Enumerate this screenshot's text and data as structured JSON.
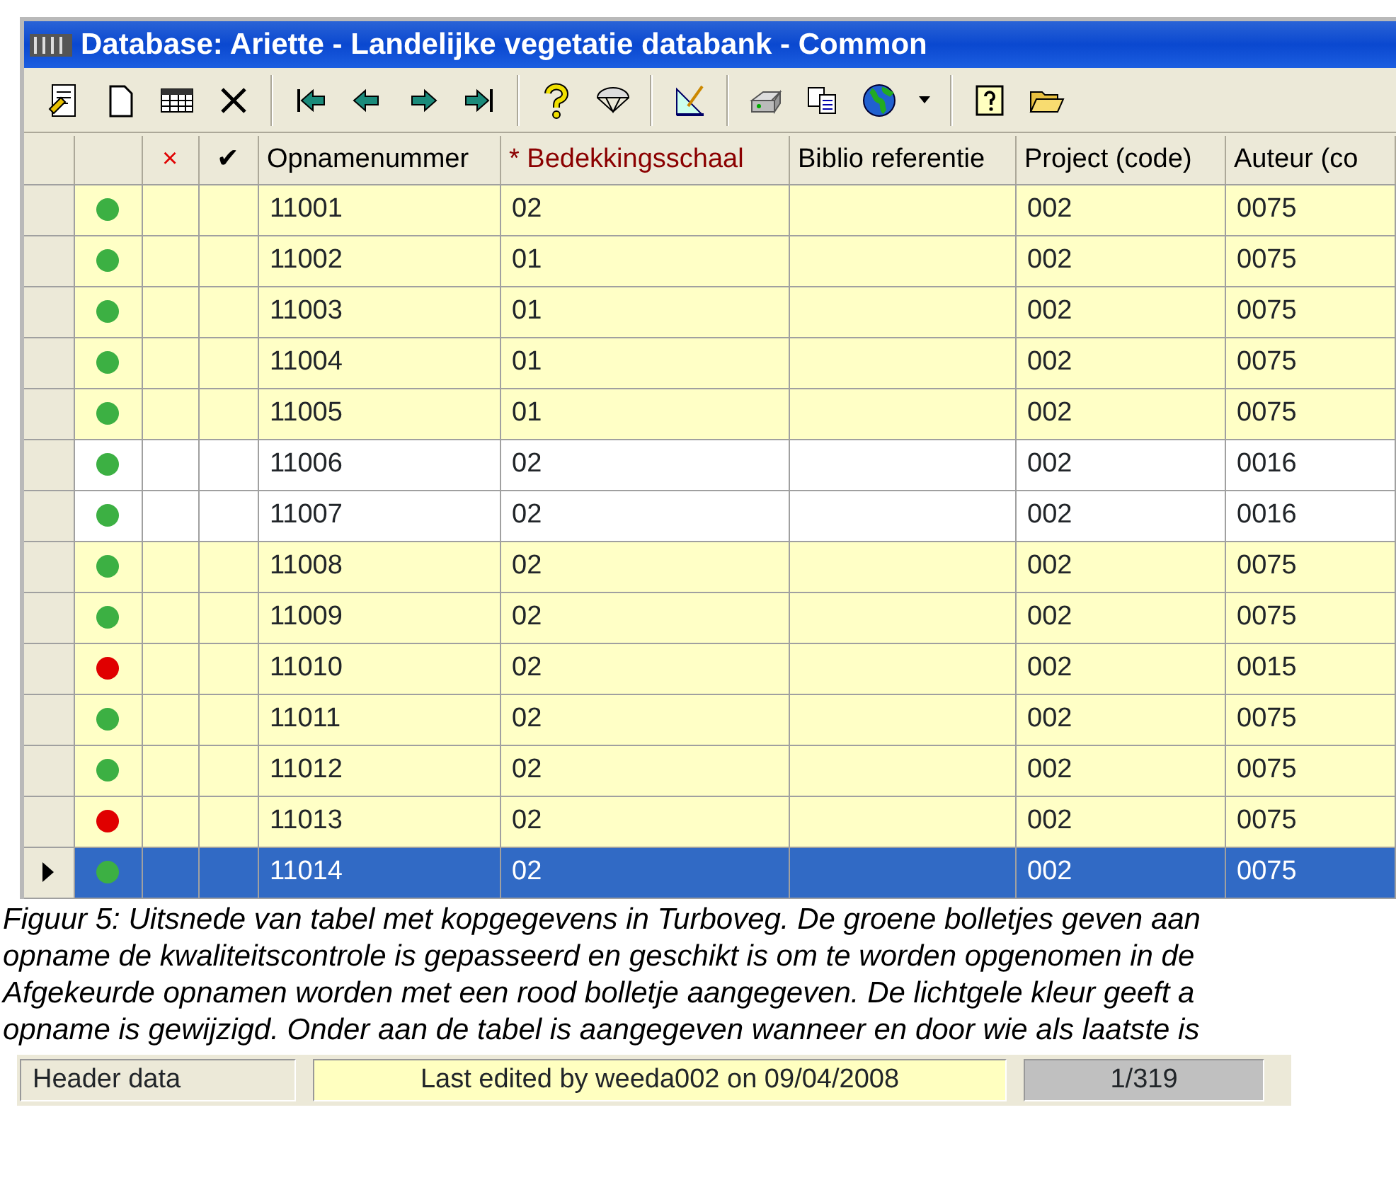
{
  "window": {
    "title": "Database: Ariette - Landelijke vegetatie databank - Common"
  },
  "toolbar": [
    {
      "kind": "editdoc"
    },
    {
      "kind": "page"
    },
    {
      "kind": "grid"
    },
    {
      "kind": "close"
    },
    {
      "kind": "sep"
    },
    {
      "kind": "first"
    },
    {
      "kind": "prev"
    },
    {
      "kind": "next"
    },
    {
      "kind": "last"
    },
    {
      "kind": "sep"
    },
    {
      "kind": "question"
    },
    {
      "kind": "parachute"
    },
    {
      "kind": "sep"
    },
    {
      "kind": "ruler"
    },
    {
      "kind": "sep"
    },
    {
      "kind": "printer"
    },
    {
      "kind": "copy"
    },
    {
      "kind": "globe"
    },
    {
      "kind": "caret"
    },
    {
      "kind": "sep"
    },
    {
      "kind": "help"
    },
    {
      "kind": "folder"
    }
  ],
  "table": {
    "columns": [
      {
        "kind": "indicator"
      },
      {
        "kind": "dot"
      },
      {
        "kind": "text",
        "label": "×",
        "color": "#e00000"
      },
      {
        "kind": "text",
        "label": "✔",
        "color": "#000000"
      },
      {
        "kind": "text",
        "label": "Opnamenummer",
        "color": "#000000"
      },
      {
        "kind": "text",
        "label": "* Bedekkingsschaal",
        "color": "#8b0000"
      },
      {
        "kind": "text",
        "label": "Biblio referentie",
        "color": "#000000"
      },
      {
        "kind": "text",
        "label": "Project (code)",
        "color": "#000000"
      },
      {
        "kind": "text",
        "label": "Auteur (co",
        "color": "#000000"
      }
    ],
    "rows": [
      {
        "color": "#3cb043",
        "modified": true,
        "selected": false,
        "cells": [
          "",
          "",
          "",
          "",
          "11001",
          "02",
          "",
          "002",
          "0075"
        ]
      },
      {
        "color": "#3cb043",
        "modified": true,
        "selected": false,
        "cells": [
          "",
          "",
          "",
          "",
          "11002",
          "01",
          "",
          "002",
          "0075"
        ]
      },
      {
        "color": "#3cb043",
        "modified": true,
        "selected": false,
        "cells": [
          "",
          "",
          "",
          "",
          "11003",
          "01",
          "",
          "002",
          "0075"
        ]
      },
      {
        "color": "#3cb043",
        "modified": true,
        "selected": false,
        "cells": [
          "",
          "",
          "",
          "",
          "11004",
          "01",
          "",
          "002",
          "0075"
        ]
      },
      {
        "color": "#3cb043",
        "modified": true,
        "selected": false,
        "cells": [
          "",
          "",
          "",
          "",
          "11005",
          "01",
          "",
          "002",
          "0075"
        ]
      },
      {
        "color": "#3cb043",
        "modified": false,
        "selected": false,
        "cells": [
          "",
          "",
          "",
          "",
          "11006",
          "02",
          "",
          "002",
          "0016"
        ]
      },
      {
        "color": "#3cb043",
        "modified": false,
        "selected": false,
        "cells": [
          "",
          "",
          "",
          "",
          "11007",
          "02",
          "",
          "002",
          "0016"
        ]
      },
      {
        "color": "#3cb043",
        "modified": true,
        "selected": false,
        "cells": [
          "",
          "",
          "",
          "",
          "11008",
          "02",
          "",
          "002",
          "0075"
        ]
      },
      {
        "color": "#3cb043",
        "modified": true,
        "selected": false,
        "cells": [
          "",
          "",
          "",
          "",
          "11009",
          "02",
          "",
          "002",
          "0075"
        ]
      },
      {
        "color": "#e00000",
        "modified": true,
        "selected": false,
        "cells": [
          "",
          "",
          "",
          "",
          "11010",
          "02",
          "",
          "002",
          "0015"
        ]
      },
      {
        "color": "#3cb043",
        "modified": true,
        "selected": false,
        "cells": [
          "",
          "",
          "",
          "",
          "11011",
          "02",
          "",
          "002",
          "0075"
        ]
      },
      {
        "color": "#3cb043",
        "modified": true,
        "selected": false,
        "cells": [
          "",
          "",
          "",
          "",
          "11012",
          "02",
          "",
          "002",
          "0075"
        ]
      },
      {
        "color": "#e00000",
        "modified": true,
        "selected": false,
        "cells": [
          "",
          "",
          "",
          "",
          "11013",
          "02",
          "",
          "002",
          "0075"
        ]
      },
      {
        "color": "#3cb043",
        "modified": true,
        "selected": true,
        "cells": [
          "",
          "",
          "",
          "",
          "11014",
          "02",
          "",
          "002",
          "0075"
        ]
      }
    ]
  },
  "caption": [
    "Figuur 5: Uitsnede van tabel met kopgegevens in Turboveg. De groene bolletjes geven aan",
    "opname de kwaliteitscontrole is gepasseerd en geschikt is om te worden opgenomen in de",
    "Afgekeurde opnamen worden met een rood bolletje aangegeven. De lichtgele kleur geeft a",
    "opname is gewijzigd. Onder aan de tabel is aangegeven wanneer en door wie als laatste is"
  ],
  "status_bar": {
    "section": "Header data",
    "last_edited": "Last edited by weeda002 on 09/04/2008",
    "record": "1/319"
  }
}
